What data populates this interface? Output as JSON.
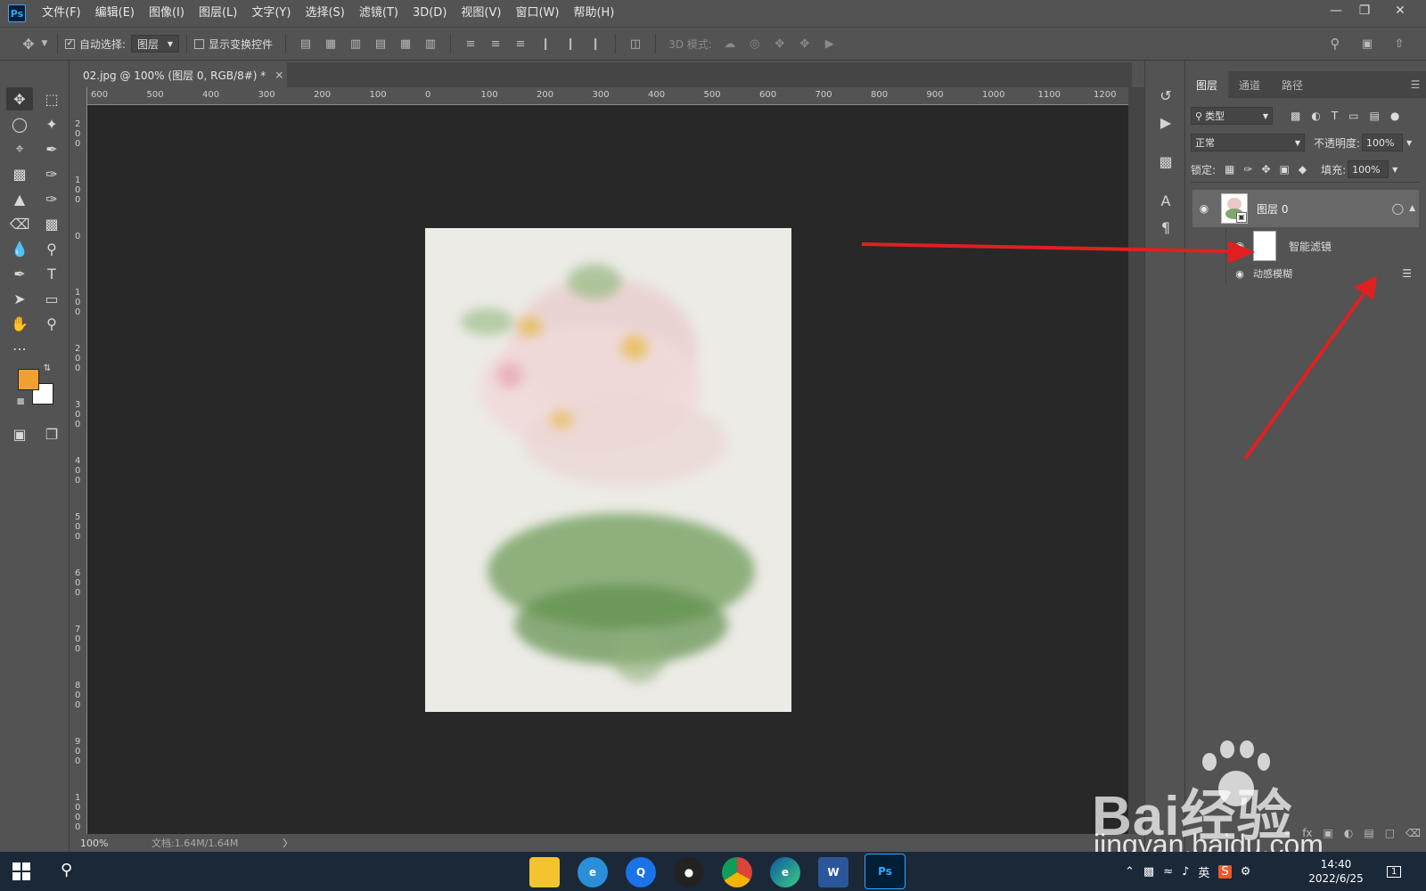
{
  "app": {
    "logo": "Ps"
  },
  "menu": [
    "文件(F)",
    "编辑(E)",
    "图像(I)",
    "图层(L)",
    "文字(Y)",
    "选择(S)",
    "滤镜(T)",
    "3D(D)",
    "视图(V)",
    "窗口(W)",
    "帮助(H)"
  ],
  "options": {
    "auto_select_label": "自动选择:",
    "auto_select_value": "图层",
    "show_transform_label": "显示变换控件",
    "mode_3d_label": "3D 模式:"
  },
  "document": {
    "tab_title": "02.jpg @ 100% (图层 0, RGB/8#) *",
    "close_glyph": "×"
  },
  "ruler_h": [
    "600",
    "500",
    "400",
    "300",
    "200",
    "100",
    "0",
    "100",
    "200",
    "300",
    "400",
    "500",
    "600",
    "700",
    "800",
    "900",
    "1000",
    "1100",
    "1200"
  ],
  "ruler_v": [
    "200",
    "100",
    "0",
    "100",
    "200",
    "300",
    "400",
    "500",
    "600",
    "700",
    "800",
    "900",
    "1000"
  ],
  "status": {
    "zoom": "100%",
    "doc": "文档:1.64M/1.64M",
    "arrow": "〉"
  },
  "colors": {
    "foreground": "#f0a030",
    "background": "#ffffff",
    "arrow": "#e02020"
  },
  "panel": {
    "tabs": [
      "图层",
      "通道",
      "路径"
    ],
    "filter_kind": "类型",
    "blend_mode": "正常",
    "opacity_label": "不透明度:",
    "opacity_value": "100%",
    "lock_label": "锁定:",
    "fill_label": "填充:",
    "fill_value": "100%",
    "layer_name": "图层 0",
    "smart_filters_label": "智能滤镜",
    "filter_name": "动感模糊"
  },
  "taskbar": {
    "apps": [
      "file-explorer",
      "ie-browser",
      "qq-browser",
      "qq",
      "chrome",
      "edge",
      "word",
      "photoshop"
    ],
    "ime": "英",
    "time": "14:40",
    "date": "2022/6/25",
    "notifications": "1"
  },
  "watermark": {
    "brand": "Bai经验",
    "url": "jingyan.baidu.com"
  }
}
